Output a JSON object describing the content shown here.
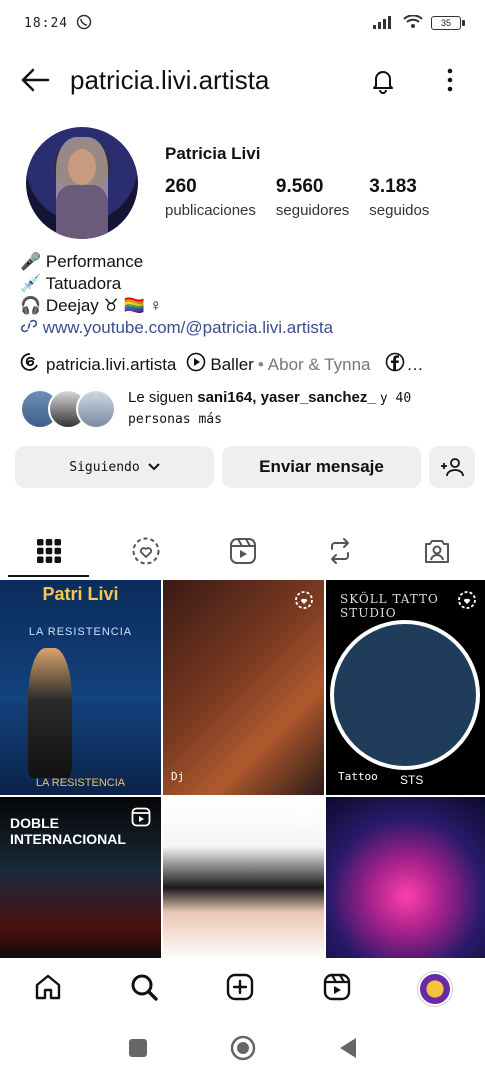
{
  "status_bar": {
    "time": "18:24",
    "battery": "35"
  },
  "header": {
    "username": "patricia.livi.artista"
  },
  "profile": {
    "name": "Patricia Livi",
    "stats": [
      {
        "value": "260",
        "label": "publicaciones"
      },
      {
        "value": "9.560",
        "label": "seguidores"
      },
      {
        "value": "3.183",
        "label": "seguidos"
      }
    ],
    "bio": {
      "line1": "🎤 Performance",
      "line2": "💉 Tatuadora",
      "line3": "🎧 Deejay ♉ 🏳️‍🌈 ♀",
      "link": "www.youtube.com/@patricia.livi.artista"
    },
    "tags": {
      "threads": "patricia.livi.artista",
      "music": "Baller",
      "music_artist": "Abor & Tynna",
      "ellipsis": "…"
    },
    "followed_by": {
      "prefix": "Le siguen",
      "names": "sani164, yaser_sanchez_",
      "suffix": "y 40",
      "more": "personas más"
    }
  },
  "buttons": {
    "following": "Siguiendo",
    "message": "Enviar mensaje"
  },
  "grid": {
    "post1": {
      "title": "Patri Livi",
      "subtitle": "LA RESISTENCIA",
      "bottom": "LA RESISTENCIA"
    },
    "post2": {
      "label": "Dj"
    },
    "post3": {
      "title": "SKÖLL TATTO STUDIO",
      "label": "Tattoo",
      "code": "STS"
    },
    "post4": {
      "title": "DOBLE INTERNACIONAL"
    }
  },
  "colors": {
    "link": "#3a4f8c",
    "button_bg": "#efefef"
  }
}
